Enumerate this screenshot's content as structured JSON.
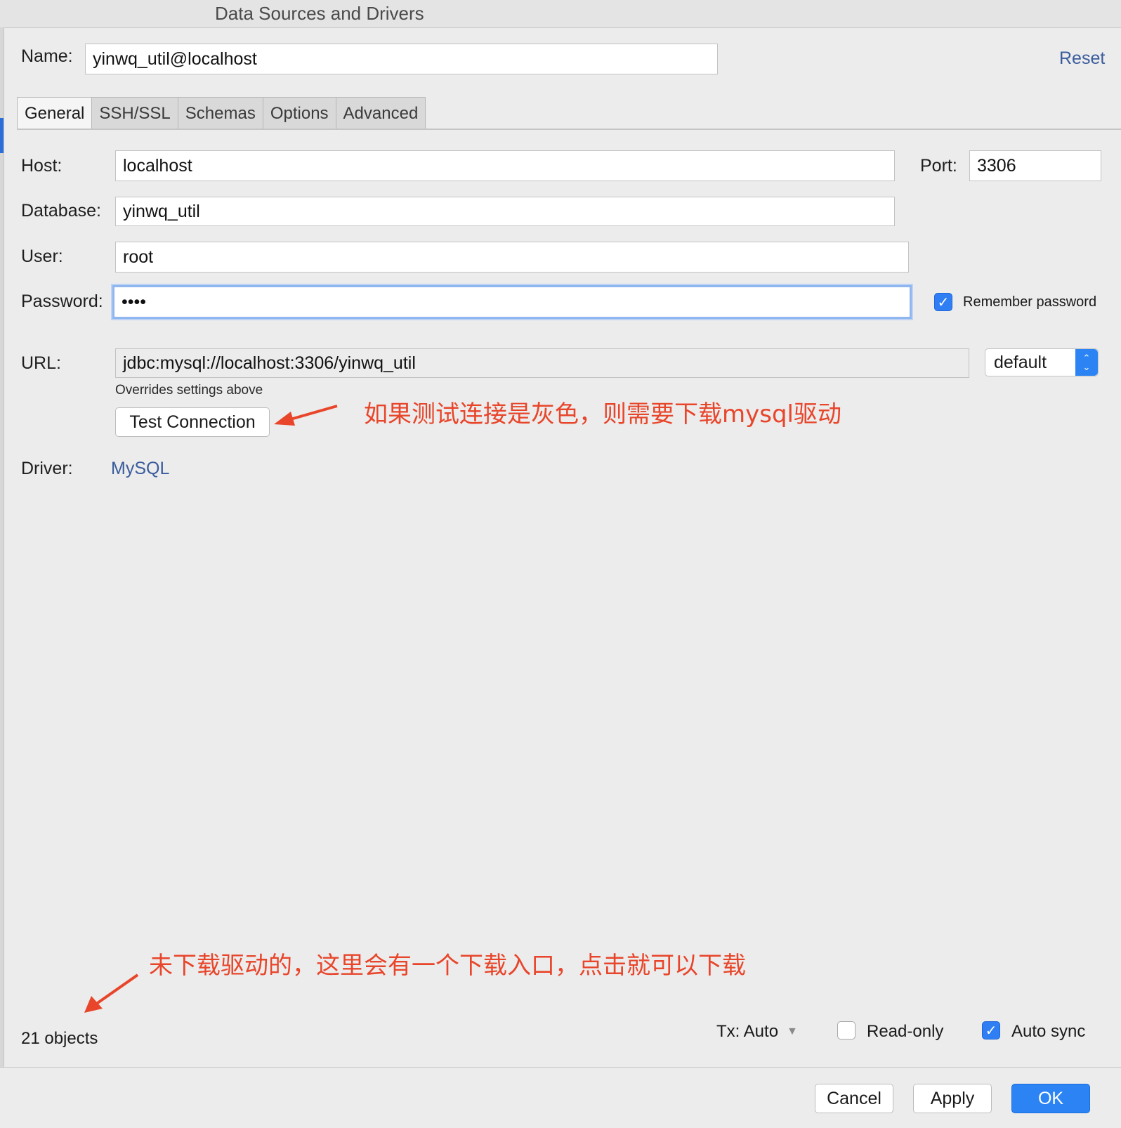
{
  "window": {
    "title": "Data Sources and Drivers"
  },
  "name_row": {
    "label": "Name:",
    "value": "yinwq_util@localhost",
    "reset": "Reset"
  },
  "tabs": [
    {
      "label": "General",
      "active": true
    },
    {
      "label": "SSH/SSL"
    },
    {
      "label": "Schemas"
    },
    {
      "label": "Options"
    },
    {
      "label": "Advanced"
    }
  ],
  "general": {
    "host": {
      "label": "Host:",
      "value": "localhost"
    },
    "port": {
      "label": "Port:",
      "value": "3306"
    },
    "database": {
      "label": "Database:",
      "value": "yinwq_util"
    },
    "user": {
      "label": "User:",
      "value": "root"
    },
    "password": {
      "label": "Password:",
      "value": "••••"
    },
    "remember_password": {
      "label": "Remember password",
      "checked": true
    },
    "url": {
      "label": "URL:",
      "value": "jdbc:mysql://localhost:3306/yinwq_util",
      "hint": "Overrides settings above"
    },
    "url_mode": {
      "value": "default"
    },
    "test_connection": "Test Connection",
    "driver": {
      "label": "Driver:",
      "value": "MySQL"
    }
  },
  "annotations": {
    "test_connection_note": "如果测试连接是灰色，则需要下载mysql驱动",
    "download_note": "未下载驱动的，这里会有一个下载入口，点击就可以下载",
    "color": "#e8452a"
  },
  "status": {
    "objects": "21 objects",
    "tx": "Tx: Auto",
    "read_only": {
      "label": "Read-only",
      "checked": false
    },
    "auto_sync": {
      "label": "Auto sync",
      "checked": true
    }
  },
  "buttons": {
    "cancel": "Cancel",
    "apply": "Apply",
    "ok": "OK"
  },
  "colors": {
    "accent": "#2c84f4",
    "link": "#3a5c9c"
  }
}
